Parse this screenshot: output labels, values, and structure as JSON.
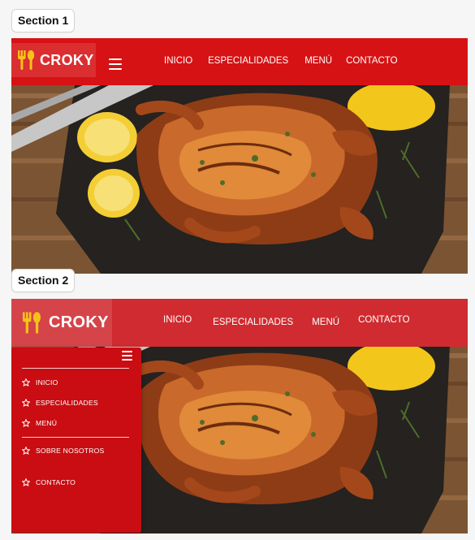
{
  "sections": [
    {
      "label": "Section 1",
      "brand": "CROKY",
      "nav": [
        "INICIO",
        "ESPECIALIDADES",
        "MENÚ",
        "CONTACTO"
      ]
    },
    {
      "label": "Section 2",
      "brand": "CROKY",
      "nav": [
        "INICIO",
        "ESPECIALIDADES",
        "MENÚ",
        "CONTACTO"
      ],
      "side_menu": {
        "items": [
          "INICIO",
          "ESPECIALIDADES",
          "MENÚ",
          "SOBRE NOSOTROS",
          "CONTACTO"
        ]
      }
    }
  ],
  "icons": {
    "logo": "fork-spoon-icon",
    "menu": "hamburger-menu-icon",
    "menu_item": "star-outline-icon"
  },
  "colors": {
    "brand_red": "#d71214",
    "menu_red": "#c90d12",
    "logo_yellow": "#f6c21a",
    "text": "#ffffff"
  }
}
